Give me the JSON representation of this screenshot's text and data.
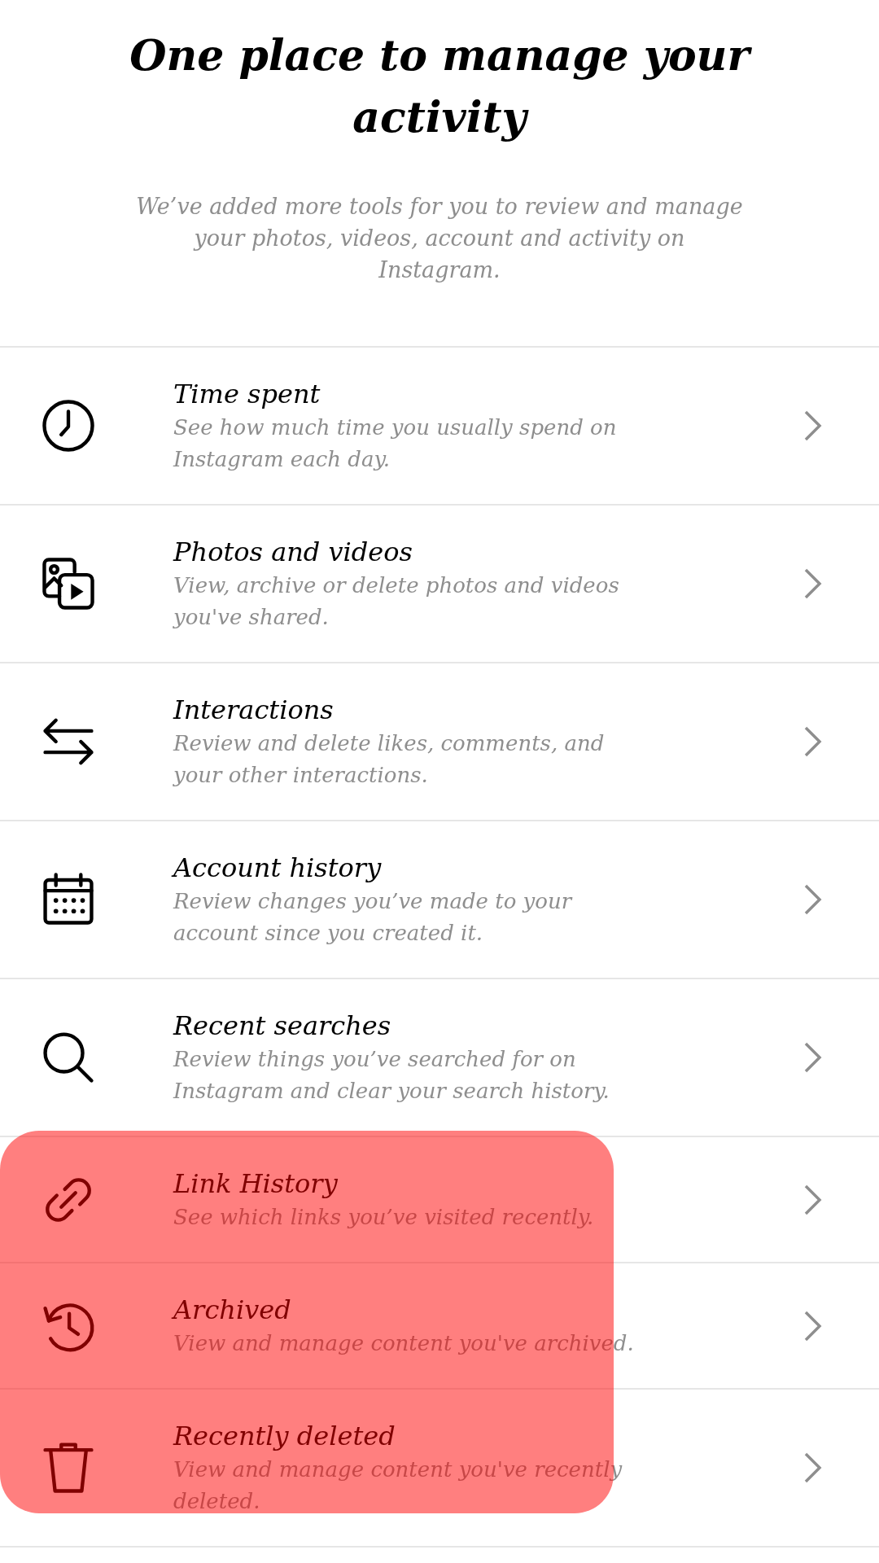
{
  "header": {
    "title": "One place to manage your activity",
    "subtitle": "We’ve added more tools for you to review and manage your photos, videos, account and activity on Instagram."
  },
  "items": [
    {
      "title": "Time spent",
      "description": "See how much time you usually spend on Instagram each day.",
      "highlighted": false
    },
    {
      "title": "Photos and videos",
      "description": "View, archive or delete photos and videos you've shared.",
      "highlighted": false
    },
    {
      "title": "Interactions",
      "description": "Review and delete likes, comments, and your other interactions.",
      "highlighted": false
    },
    {
      "title": "Account history",
      "description": "Review changes you’ve made to your account since you created it.",
      "highlighted": false
    },
    {
      "title": "Recent searches",
      "description": "Review things you’ve searched for on Instagram and clear your search history.",
      "highlighted": false
    },
    {
      "title": "Link History",
      "description": "See which links you’ve visited recently.",
      "highlighted": true
    },
    {
      "title": "Archived",
      "description": "View and manage content you've archived.",
      "highlighted": true
    },
    {
      "title": "Recently deleted",
      "description": "View and manage content you've recently deleted.",
      "highlighted": true
    }
  ]
}
